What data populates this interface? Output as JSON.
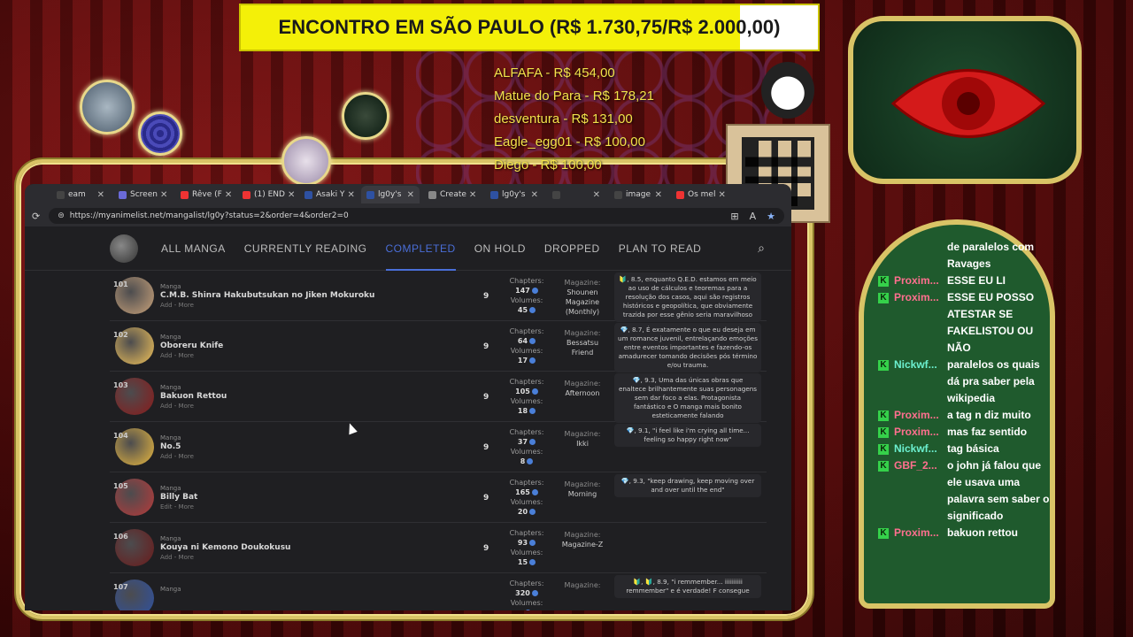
{
  "goal": {
    "text": "ENCONTRO EM SÃO PAULO (R$ 1.730,75/R$ 2.000,00)",
    "raised": 1730.75,
    "target": 2000,
    "banner_color": "#f4f008"
  },
  "donors": [
    "ALFAFA - R$ 454,00",
    "Matue do Para - R$ 178,21",
    "desventura - R$ 131,00",
    "Eagle_egg01 - R$ 100,00",
    "Diego - R$ 100,00"
  ],
  "browser": {
    "tabs": [
      {
        "label": "eam",
        "favicon": "#444"
      },
      {
        "label": "Screen",
        "favicon": "#6a6ad8"
      },
      {
        "label": "Rêve (F",
        "favicon": "#e33"
      },
      {
        "label": "(1) END",
        "favicon": "#e33"
      },
      {
        "label": "Asaki Y",
        "favicon": "#2e51a2"
      },
      {
        "label": "lg0y's",
        "favicon": "#2e51a2"
      },
      {
        "label": "Create",
        "favicon": "#888"
      },
      {
        "label": "lg0y's",
        "favicon": "#2e51a2"
      },
      {
        "label": "",
        "favicon": "#444"
      },
      {
        "label": "image",
        "favicon": "#444"
      },
      {
        "label": "Os mel",
        "favicon": "#e33"
      }
    ],
    "url": "https://myanimelist.net/mangalist/lg0y?status=2&order=4&order2=0"
  },
  "nav": {
    "tabs": [
      "ALL MANGA",
      "CURRENTLY READING",
      "COMPLETED",
      "ON HOLD",
      "DROPPED",
      "PLAN TO READ"
    ],
    "active": "COMPLETED"
  },
  "manga": [
    {
      "rank": "101",
      "kind": "Manga",
      "title": "C.M.B. Shinra Hakubutsukan no Jiken Mokuroku",
      "links": "Add - More",
      "score": "9",
      "chapters": "147",
      "volumes": "45",
      "mag_label": "Magazine:",
      "magazine": "Shounen Magazine (Monthly)",
      "note": "🔰, 8.5, enquanto Q.E.D. estamos em meio ao uso de cálculos e teoremas para a resolução dos casos, aqui são registros históricos e geopolítica, que obviamente trazida por esse gênio seria maravilhoso",
      "thumb": "#c9a27a"
    },
    {
      "rank": "102",
      "kind": "Manga",
      "title": "Oboreru Knife",
      "links": "Add - More",
      "score": "9",
      "chapters": "64",
      "volumes": "17",
      "mag_label": "Magazine:",
      "magazine": "Bessatsu Friend",
      "note": "💎, 8.7, É exatamente o que eu deseja em um romance juvenil, entrelaçando emoções entre eventos importantes e fazendo-os amadurecer tomando decisões pós término e/ou trauma.",
      "thumb": "#f2c35a"
    },
    {
      "rank": "103",
      "kind": "Manga",
      "title": "Bakuon Rettou",
      "links": "Add - More",
      "score": "9",
      "chapters": "105",
      "volumes": "18",
      "mag_label": "Magazine:",
      "magazine": "Afternoon",
      "note": "💎, 9.3, Uma das únicas obras que enaltece brilhantemente suas personagens sem dar foco a elas. Protagonista fantástico e O manga mais bonito esteticamente falando",
      "thumb": "#8a1a1a"
    },
    {
      "rank": "104",
      "kind": "Manga",
      "title": "No.5",
      "links": "Add - More",
      "score": "9",
      "chapters": "37",
      "volumes": "8",
      "mag_label": "Magazine:",
      "magazine": "Ikki",
      "note": "💎, 9.1, \"i feel like i'm crying all time... feeling so happy right now\"",
      "thumb": "#e8b840"
    },
    {
      "rank": "105",
      "kind": "Manga",
      "title": "Billy Bat",
      "links": "Edit - More",
      "score": "9",
      "chapters": "165",
      "volumes": "20",
      "mag_label": "Magazine:",
      "magazine": "Morning",
      "note": "💎, 9.3, \"keep drawing, keep moving over and over until the end\"",
      "thumb": "#b83a3a"
    },
    {
      "rank": "106",
      "kind": "Manga",
      "title": "Kouya ni Kemono Doukokusu",
      "links": "Add - More",
      "score": "9",
      "chapters": "93",
      "volumes": "15",
      "mag_label": "Magazine:",
      "magazine": "Magazine-Z",
      "note": "",
      "thumb": "#6a1a1a"
    },
    {
      "rank": "107",
      "kind": "Manga",
      "title": "",
      "links": "",
      "score": "",
      "chapters": "320",
      "volumes": "",
      "mag_label": "Magazine:",
      "magazine": "",
      "note": "🔰, 🔰, 8.9, \"i remmember... iiiiiiiiii remmember\" e é verdade! F consegue",
      "thumb": "#2e51a2"
    }
  ],
  "labels": {
    "chapters": "Chapters:",
    "volumes": "Volumes:"
  },
  "chat": [
    {
      "user": "",
      "msg": "de paralelos com Ravages",
      "color": "pink",
      "cont": true
    },
    {
      "user": "Proxim...",
      "msg": "ESSE EU LI",
      "color": "pink"
    },
    {
      "user": "Proxim...",
      "msg": "ESSE EU POSSO ATESTAR SE FAKELISTOU OU NÃO",
      "color": "pink"
    },
    {
      "user": "Nickwf...",
      "msg": "paralelos os quais dá pra saber pela wikipedia",
      "color": "green"
    },
    {
      "user": "Proxim...",
      "msg": "a tag n diz muito",
      "color": "pink"
    },
    {
      "user": "Proxim...",
      "msg": "mas faz sentido",
      "color": "pink"
    },
    {
      "user": "Nickwf...",
      "msg": "tag básica",
      "color": "green"
    },
    {
      "user": "GBF_2...",
      "msg": "o john já falou que ele usava uma palavra sem saber o significado",
      "color": "pink"
    },
    {
      "user": "Proxim...",
      "msg": "bakuon rettou",
      "color": "pink"
    }
  ],
  "chat_badge": "K"
}
